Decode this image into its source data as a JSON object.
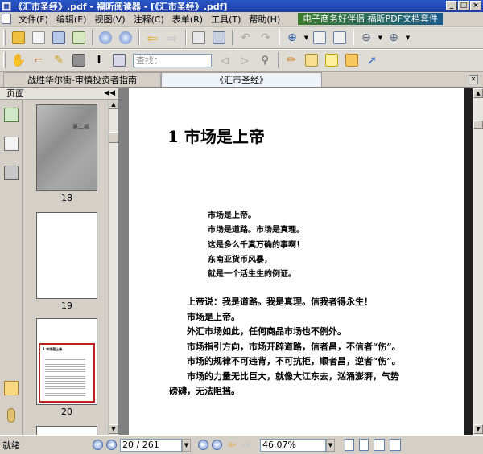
{
  "window": {
    "title": "《汇市圣经》.pdf - 福昕阅读器 - [《汇市圣经》.pdf]",
    "buttons": [
      "_",
      "□",
      "×"
    ]
  },
  "menu": {
    "items": [
      "文件(F)",
      "编辑(E)",
      "视图(V)",
      "注释(C)",
      "表单(R)",
      "工具(T)",
      "帮助(H)"
    ],
    "banner": "电子商务好伴侣  福昕PDF文档套件"
  },
  "toolbar": {
    "search_placeholder": "查找："
  },
  "tabs": [
    {
      "label": "战胜华尔街-审慎投资者指南"
    },
    {
      "label": "《汇市圣经》"
    }
  ],
  "nav": {
    "header": "页面",
    "pages": [
      "18",
      "19",
      "20"
    ],
    "page18_text": "第二部",
    "page20_heading": "1 市场是上帝"
  },
  "document": {
    "chapter_title": "1 市场是上帝",
    "poem": [
      "市场是上帝。",
      "市场是道路。市场是真理。",
      "这是多么千真万确的事啊！",
      "东南亚货币风暴，",
      "就是一个活生生的例证。"
    ],
    "paragraphs": [
      "上帝说：我是道路。我是真理。信我者得永生！",
      "市场是上帝。",
      "外汇市场如此，任何商品市场也不例外。",
      "市场指引方向，市场开辟道路，信者昌，不信者“伤”。",
      "市场的规律不可违背，不可抗拒，顺者昌，逆者“伤”。",
      "市场的力量无比巨大，就像大江东去，汹涌澎湃，气势",
      "磅礴，无法阻挡。"
    ]
  },
  "status": {
    "ready": "就绪",
    "page_field": "20 / 261",
    "zoom": "46.07%"
  },
  "colors": {
    "titlebar": "#1a40a8",
    "page20_frame": "#c02020"
  }
}
